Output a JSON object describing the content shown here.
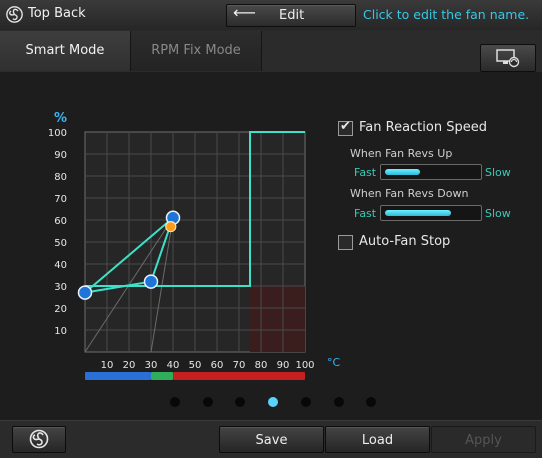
{
  "title_bar": {
    "fan_name": "Top Back",
    "edit_button_label": "Edit",
    "edit_hint": "Click to edit the fan name."
  },
  "tabs": [
    {
      "label": "Smart Mode",
      "active": true
    },
    {
      "label": "RPM Fix Mode",
      "active": false
    }
  ],
  "chart_data": {
    "type": "line",
    "ylabel": "%",
    "xlabel": "°C",
    "x_ticks": [
      "10",
      "20",
      "30",
      "40",
      "50",
      "60",
      "70",
      "80",
      "90",
      "100"
    ],
    "y_ticks": [
      "10",
      "20",
      "30",
      "40",
      "50",
      "60",
      "70",
      "80",
      "90",
      "100"
    ],
    "xlim": [
      0,
      100
    ],
    "ylim": [
      0,
      100
    ],
    "grid": true,
    "series": [
      {
        "points": [
          [
            0,
            27
          ],
          [
            30,
            32
          ],
          [
            40,
            61
          ],
          [
            0,
            27
          ]
        ],
        "color": "#3de0c8"
      }
    ],
    "threshold_line": {
      "points": [
        [
          0,
          30
        ],
        [
          75,
          30
        ],
        [
          75,
          100
        ],
        [
          100,
          100
        ]
      ],
      "color": "#3de0c8"
    },
    "current_point": {
      "x": 39,
      "y": 57,
      "color": "#ff9a1a"
    },
    "temperature_bar": [
      {
        "from": 0,
        "to": 30,
        "color": "#2a6fd6"
      },
      {
        "from": 30,
        "to": 40,
        "color": "#2eae5a"
      },
      {
        "from": 40,
        "to": 100,
        "color": "#c4201f"
      }
    ]
  },
  "settings": {
    "fan_reaction_speed": {
      "label": "Fan Reaction Speed",
      "checked": true
    },
    "revs_up": {
      "label": "When Fan Revs Up",
      "fast": "Fast",
      "slow": "Slow",
      "level": 0.38
    },
    "revs_down": {
      "label": "When Fan Revs Down",
      "fast": "Fast",
      "slow": "Slow",
      "level": 0.72
    },
    "auto_fan_stop": {
      "label": "Auto-Fan Stop",
      "checked": false
    }
  },
  "pagination": {
    "count": 7,
    "active_index": 3,
    "active_color": "#5ad2ff",
    "inactive_color": "#080808"
  },
  "bottom": {
    "save_label": "Save",
    "load_label": "Load",
    "apply_label": "Apply"
  }
}
